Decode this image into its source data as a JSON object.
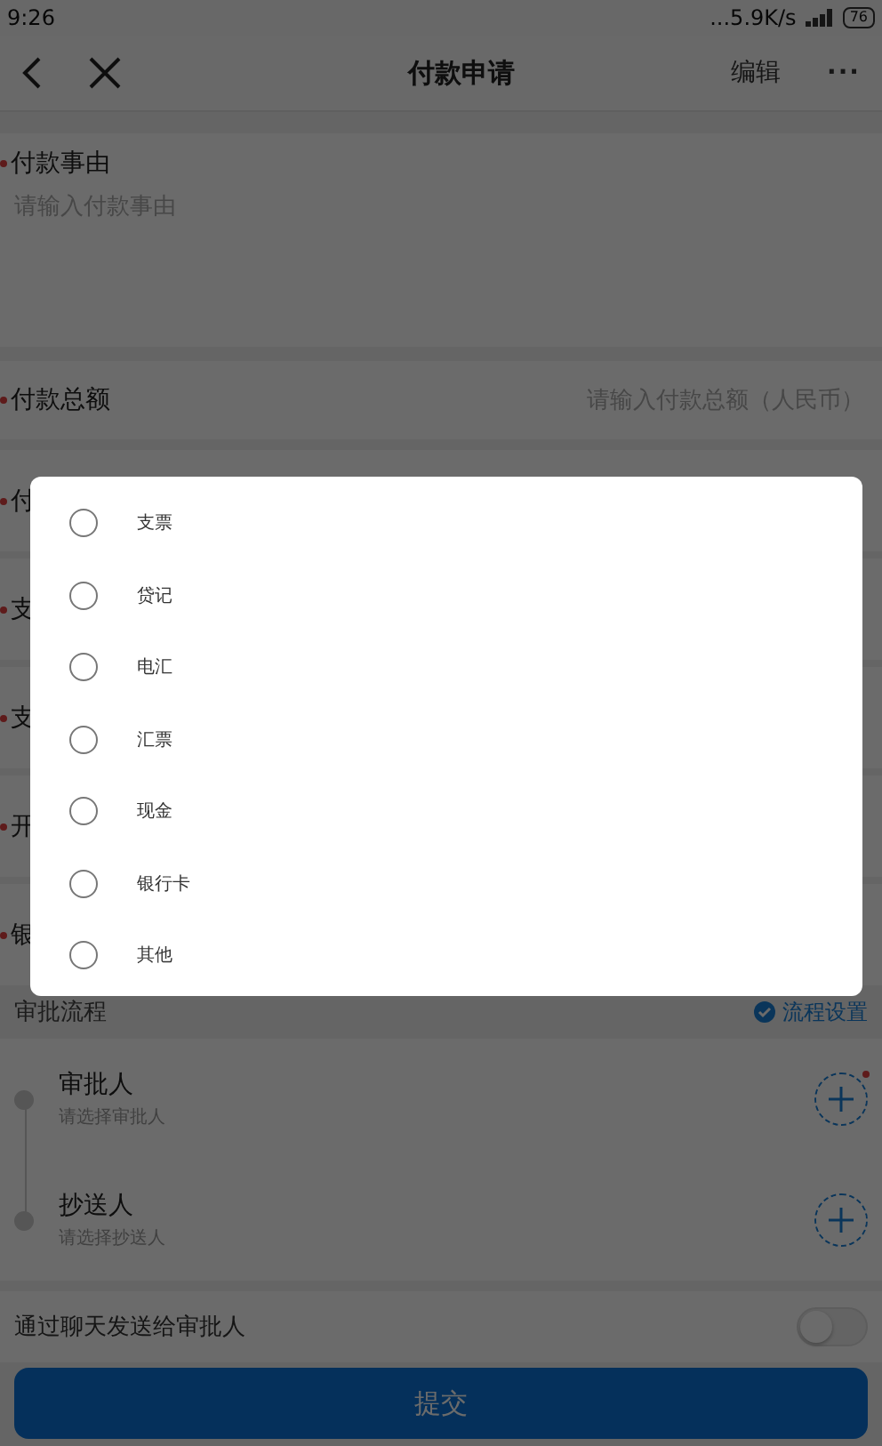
{
  "status_bar": {
    "time": "9:26",
    "net_speed": "...5.9K/s",
    "battery": "76"
  },
  "header": {
    "title": "付款申请",
    "edit": "编辑",
    "more": "···"
  },
  "reason": {
    "label": "付款事由",
    "required": true,
    "placeholder": "请输入付款事由"
  },
  "amount": {
    "label": "付款总额",
    "required": true,
    "placeholder": "请输入付款总额（人民币）"
  },
  "covered_rows": [
    {
      "label": "付",
      "required": true
    },
    {
      "label": "支",
      "required": true
    },
    {
      "label": "支",
      "required": true
    },
    {
      "label": "开",
      "required": true
    },
    {
      "label": "银",
      "required": true
    }
  ],
  "flow": {
    "title": "审批流程",
    "settings": "流程设置",
    "steps": [
      {
        "title": "审批人",
        "hint": "请选择审批人",
        "required": true
      },
      {
        "title": "抄送人",
        "hint": "请选择抄送人",
        "required": false
      }
    ]
  },
  "chat_toggle": {
    "label": "通过聊天发送给审批人",
    "on": false
  },
  "submit": "提交",
  "dialog": {
    "options": [
      {
        "label": "支票",
        "selected": false
      },
      {
        "label": "贷记",
        "selected": false
      },
      {
        "label": "电汇",
        "selected": false
      },
      {
        "label": "汇票",
        "selected": false
      },
      {
        "label": "现金",
        "selected": false
      },
      {
        "label": "银行卡",
        "selected": false
      },
      {
        "label": "其他",
        "selected": false
      }
    ]
  }
}
